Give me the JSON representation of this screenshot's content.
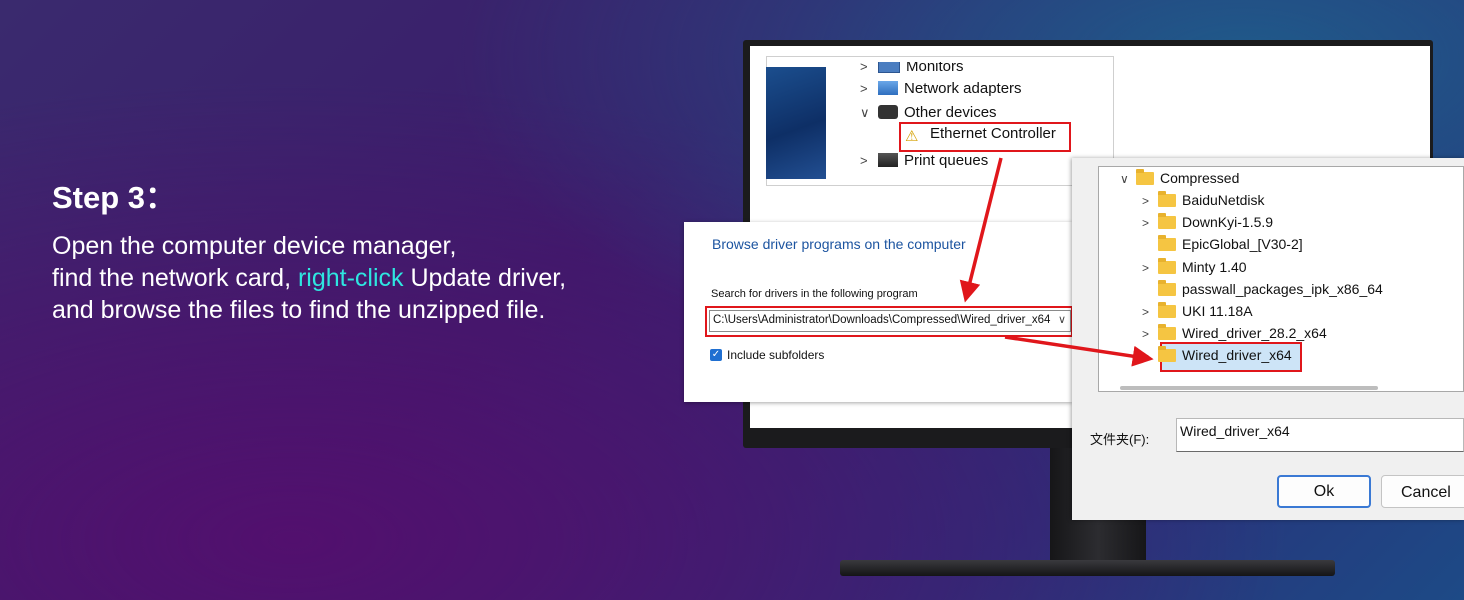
{
  "step": {
    "title": "Step 3：",
    "line1": "Open the computer device manager,",
    "line2_pre": "find the network card, ",
    "line2_highlight": "right-click",
    "line2_post": " Update driver,",
    "line3": "and browse the files to find the unzipped file."
  },
  "colors": {
    "highlight": "#2ee6e0",
    "callout_red": "#e0161b",
    "link_blue": "#1c54a0"
  },
  "device_manager": {
    "items": [
      {
        "label": "Monitors",
        "icon": "monitor-icon",
        "expander": ">"
      },
      {
        "label": "Network adapters",
        "icon": "network-adapter-icon",
        "expander": ">"
      },
      {
        "label": "Other devices",
        "icon": "other-devices-icon",
        "expander": "∨"
      },
      {
        "label": "Ethernet Controller",
        "icon": "warning-device-icon",
        "expander": ""
      },
      {
        "label": "Print queues",
        "icon": "printer-icon",
        "expander": ">"
      }
    ]
  },
  "browse_dialog": {
    "title": "Browse driver programs on the computer",
    "search_label": "Search for drivers in the following program",
    "path": "C:\\Users\\Administrator\\Downloads\\Compressed\\Wired_driver_x64",
    "include_subfolders_label": "Include subfolders",
    "include_subfolders_checked": true
  },
  "folder_dialog": {
    "tree": [
      {
        "label": "Compressed",
        "expander": "∨"
      },
      {
        "label": "BaiduNetdisk",
        "expander": ">"
      },
      {
        "label": "DownKyi-1.5.9",
        "expander": ">"
      },
      {
        "label": "EpicGlobal_[V30-2]",
        "expander": ""
      },
      {
        "label": "Minty 1.40",
        "expander": ">"
      },
      {
        "label": "passwall_packages_ipk_x86_64",
        "expander": ""
      },
      {
        "label": "UKI 11.18A",
        "expander": ">"
      },
      {
        "label": "Wired_driver_28.2_x64",
        "expander": ">"
      },
      {
        "label": "Wired_driver_x64",
        "expander": ">"
      }
    ],
    "selected": "Wired_driver_x64",
    "folder_label": "文件夹(F):",
    "folder_value": "Wired_driver_x64",
    "ok_label": "Ok",
    "cancel_label": "Cancel"
  }
}
